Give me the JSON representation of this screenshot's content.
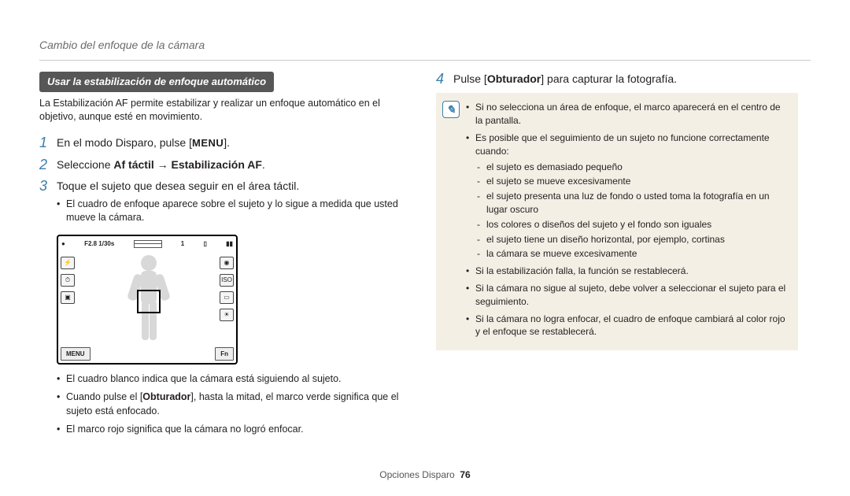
{
  "header": "Cambio del enfoque de la cámara",
  "subhead": "Usar la estabilización de enfoque automático",
  "intro": "La Estabilización AF permite estabilizar y realizar un enfoque automático en el objetivo, aunque esté en movimiento.",
  "steps": {
    "s1": {
      "num": "1",
      "pre": "En el modo Disparo, pulse [",
      "menu": "MENU",
      "post": "]."
    },
    "s2": {
      "num": "2",
      "pre": "Seleccione ",
      "b1": "Af táctil",
      "arrow": " → ",
      "b2": "Estabilización AF",
      "post": "."
    },
    "s3": {
      "num": "3",
      "text": "Toque el sujeto que desea seguir en el área táctil.",
      "sub1": "El cuadro de enfoque aparece sobre el sujeto y lo sigue a medida que usted mueve la cámara."
    },
    "s4": {
      "num": "4",
      "pre": "Pulse [",
      "b": "Obturador",
      "post": "] para capturar la fotografía."
    }
  },
  "lcd": {
    "topleft_icon": "●",
    "exposure": "F2.8 1/30s",
    "count": "1",
    "menu": "MENU",
    "fn": "Fn"
  },
  "left_bullets": {
    "b1": "El cuadro blanco indica que la cámara está siguiendo al sujeto.",
    "b2_pre": "Cuando pulse el [",
    "b2_b": "Obturador",
    "b2_post": "], hasta la mitad, el marco verde significa que el sujeto está enfocado.",
    "b3": "El marco rojo significa que la cámara no logró enfocar."
  },
  "note": {
    "n1": "Si no selecciona un área de enfoque, el marco aparecerá en el centro de la pantalla.",
    "n2": "Es posible que el seguimiento de un sujeto no funcione correctamente cuando:",
    "d1": "el sujeto es demasiado pequeño",
    "d2": "el sujeto se mueve excesivamente",
    "d3": "el sujeto presenta una luz de fondo o usted toma la fotografía en un lugar oscuro",
    "d4": "los colores o diseños del sujeto y el fondo son iguales",
    "d5": "el sujeto tiene un diseño horizontal, por ejemplo, cortinas",
    "d6": "la cámara se mueve excesivamente",
    "n3": "Si la estabilización falla, la función se restablecerá.",
    "n4": "Si la cámara no sigue al sujeto, debe volver a seleccionar el sujeto para el seguimiento.",
    "n5": "Si la cámara no logra enfocar, el cuadro de enfoque cambiará al color rojo y el enfoque se restablecerá."
  },
  "footer": {
    "section": "Opciones Disparo",
    "page": "76"
  }
}
